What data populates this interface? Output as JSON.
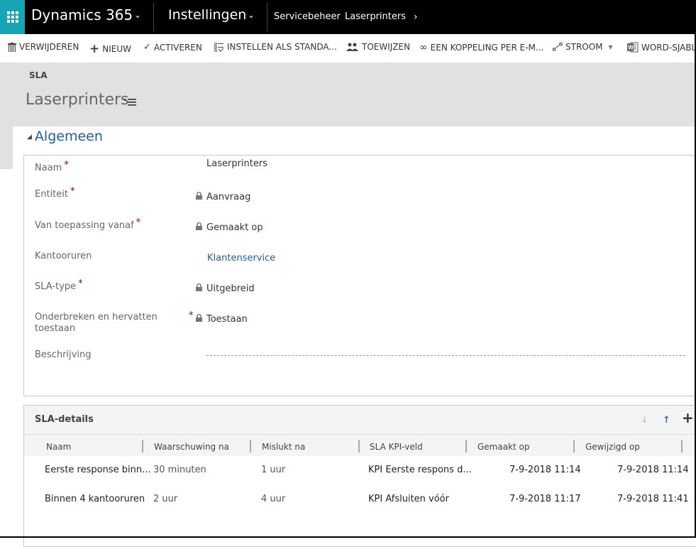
{
  "topnav": {
    "app_name": "Dynamics 365",
    "area": "Instellingen",
    "breadcrumbs": [
      "Servicebeheer",
      "Laserprinters"
    ],
    "accent_color": "#16a5b2"
  },
  "commands": [
    {
      "icon": "trash-icon",
      "label": "VERWIJDEREN"
    },
    {
      "icon": "plus-icon",
      "label": "NIEUW"
    },
    {
      "icon": "checkmark-icon",
      "label": "ACTIVEREN"
    },
    {
      "icon": "set-default-icon",
      "label": "INSTELLEN ALS STANDA..."
    },
    {
      "icon": "assign-icon",
      "label": "TOEWIJZEN"
    },
    {
      "icon": "link-icon",
      "label": "EEN KOPPELING PER E-M..."
    },
    {
      "icon": "flow-icon",
      "label": "STROOM"
    },
    {
      "icon": "word-icon",
      "label": "WORD-SJABLO"
    }
  ],
  "header": {
    "entity": "SLA",
    "record_title": "Laserprinters"
  },
  "section": {
    "title": "Algemeen",
    "fields": [
      {
        "label": "Naam",
        "required": "*",
        "value": "Laserprinters",
        "locked": false
      },
      {
        "label": "Entiteit",
        "required": "*",
        "value": "Aanvraag",
        "locked": true
      },
      {
        "label": "Van toepassing vanaf",
        "required": "*",
        "value": "Gemaakt op",
        "locked": true
      },
      {
        "label": "Kantooruren",
        "required": "",
        "value": "Klantenservice",
        "locked": false
      },
      {
        "label": "SLA-type",
        "required": "*",
        "value": "Uitgebreid",
        "locked": true
      },
      {
        "label": "Onderbreken en hervatten toestaan",
        "required": "*",
        "value": "Toestaan",
        "locked": true
      },
      {
        "label": "Beschrijving",
        "required": "",
        "value": "",
        "locked": false
      }
    ]
  },
  "subgrid": {
    "title": "SLA-details",
    "columns": [
      "Naam",
      "Waarschuwing na",
      "Mislukt na",
      "SLA KPI-veld",
      "Gemaakt op",
      "Gewijzigd op"
    ],
    "rows": [
      [
        "Eerste response binn...",
        "30 minuten",
        "1 uur",
        "KPI Eerste respons d...",
        "7-9-2018 11:14",
        "7-9-2018 11:14"
      ],
      [
        "Binnen 4 kantooruren",
        "2 uur",
        "4 uur",
        "KPI Afsluiten vóór",
        "7-9-2018 11:17",
        "7-9-2018 11:41"
      ]
    ]
  }
}
